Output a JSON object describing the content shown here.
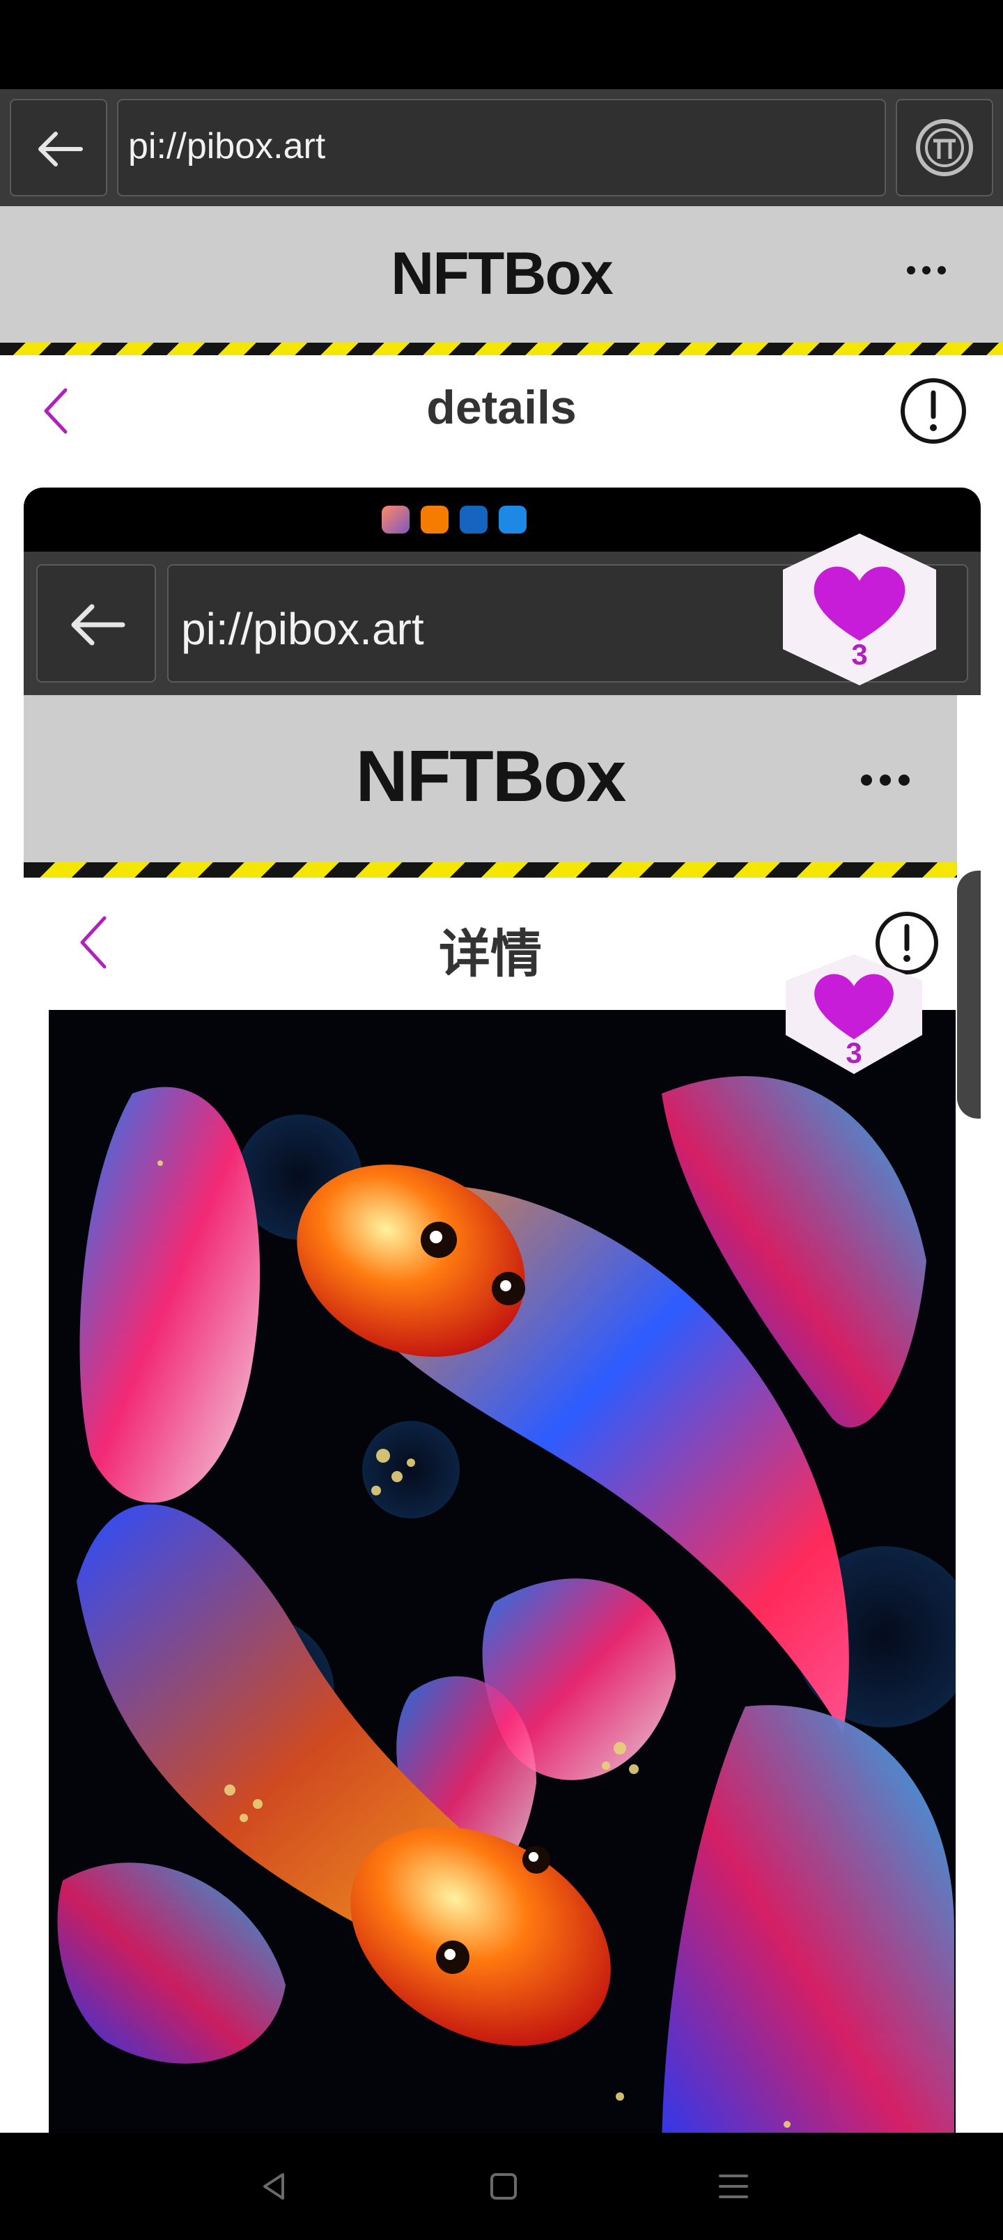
{
  "browser": {
    "url": "pi://pibox.art",
    "back_icon": "arrow-left-icon",
    "pi_icon": "pi-logo-icon"
  },
  "app": {
    "title": "NFTBox",
    "menu_icon": "more-horizontal-icon"
  },
  "page": {
    "title": "details",
    "back_icon": "chevron-left-icon",
    "info_icon": "exclamation-circle-icon"
  },
  "screenshot": {
    "url": "pi://pibox.art",
    "app_title": "NFTBox",
    "page_title": "详情",
    "like_count": "3",
    "artwork_icon": "koi-fish-artwork"
  },
  "like": {
    "count": "3",
    "icon": "heart-icon"
  },
  "colors": {
    "accent": "#b21fbf",
    "header_bg": "#cdcdcd",
    "browser_bg": "#3a3a3a",
    "stripe_yellow": "#f5e600"
  },
  "nav": {
    "back_icon": "triangle-back-icon",
    "home_icon": "square-home-icon",
    "menu_icon": "menu-lines-icon"
  }
}
